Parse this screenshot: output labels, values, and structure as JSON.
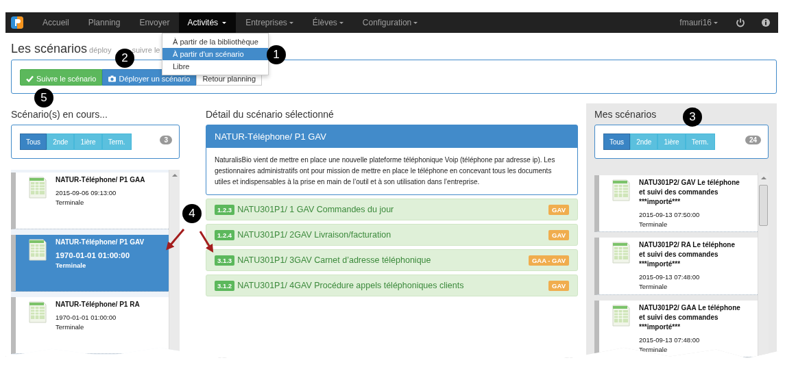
{
  "navbar": {
    "items": [
      {
        "label": "Accueil",
        "selected": false,
        "dropdown": false
      },
      {
        "label": "Planning",
        "selected": false,
        "dropdown": false
      },
      {
        "label": "Envoyer",
        "selected": false,
        "dropdown": false
      },
      {
        "label": "Activités",
        "selected": true,
        "dropdown": true
      },
      {
        "label": "Entreprises",
        "selected": false,
        "dropdown": true
      },
      {
        "label": "Élèves",
        "selected": false,
        "dropdown": true
      },
      {
        "label": "Configuration",
        "selected": false,
        "dropdown": true
      }
    ],
    "user": "fmauri16"
  },
  "dropdown_menu": [
    {
      "label": "À partir de la bibliothèque",
      "selected": false
    },
    {
      "label": "À partir d'un scénario",
      "selected": true
    },
    {
      "label": "Libre",
      "selected": false
    }
  ],
  "page_title": "Les scénarios",
  "subtitle": [
    "déploy",
    "suivre le"
  ],
  "toolbar": [
    {
      "label": "Suivre le scénario",
      "kind": "success"
    },
    {
      "label": "Déployer un scénario",
      "kind": "primary"
    },
    {
      "label": "Retour planning",
      "kind": "default"
    }
  ],
  "running": {
    "heading": "Scénario(s) en cours...",
    "filters": [
      {
        "label": "Tous",
        "selected": true
      },
      {
        "label": "2nde",
        "selected": false
      },
      {
        "label": "1ière",
        "selected": false
      },
      {
        "label": "Term.",
        "selected": false
      }
    ],
    "count": "3",
    "items": [
      {
        "title": "NATUR-Téléphone/ P1 GAA",
        "date": "2015-09-06 09:13:00",
        "level": "Terminale",
        "selected": false
      },
      {
        "title": "NATUR-Téléphone/ P1 GAV",
        "date": "1970-01-01 01:00:00",
        "level": "Terminale",
        "selected": true
      },
      {
        "title": "NATUR-Téléphone/ P1 RA",
        "date": "1970-01-01 01:00:00",
        "level": "Terminale",
        "selected": false
      }
    ]
  },
  "detail": {
    "heading": "Détail du scénario sélectionné",
    "title": "NATUR-Téléphone/ P1 GAV",
    "description": "NaturalisBio vient de mettre en place une nouvelle plateforme téléphonique Voip (téléphone par adresse ip). Les gestionnaires administratifs ont pour mission de mettre en place le téléphone en concevant tous les documents utiles et indispensables à la prise en main de l’outil et à son utilisation dans l’entreprise.",
    "activities": [
      {
        "code": "1.2.3",
        "title": "NATU301P1/ 1 GAV Commandes du jour",
        "tag": "GAV"
      },
      {
        "code": "1.2.4",
        "title": "NATU301P1/ 2GAV Livraison/facturation",
        "tag": "GAV"
      },
      {
        "code": "3.1.3",
        "title": "NATU301P1/ 3GAV Carnet d’adresse téléphonique",
        "tag": "GAA - GAV"
      },
      {
        "code": "3.1.2",
        "title": "NATU301P1/ 4GAV Procédure appels téléphoniques clients",
        "tag": "GAV"
      }
    ]
  },
  "mine": {
    "heading": "Mes scénarios",
    "filters": [
      {
        "label": "Tous",
        "selected": true
      },
      {
        "label": "2nde",
        "selected": false
      },
      {
        "label": "1ière",
        "selected": false
      },
      {
        "label": "Term.",
        "selected": false
      }
    ],
    "count": "24",
    "items": [
      {
        "title": "NATU301P2/ GAV Le téléphone et suivi des commandes ***importé***",
        "date": "2015-09-13 07:50:00",
        "level": "Terminale",
        "selected": false
      },
      {
        "title": "NATU301P2/ RA Le téléphone et suivi des commandes ***importé***",
        "date": "2015-09-13 07:48:00",
        "level": "Terminale",
        "selected": false
      },
      {
        "title": "NATU301P2/ GAA Le téléphone et suivi des commandes ***importé***",
        "date": "2015-09-13 07:48:00",
        "level": "Terminale",
        "selected": false
      }
    ]
  },
  "callouts": [
    "1",
    "2",
    "3",
    "4",
    "5"
  ]
}
